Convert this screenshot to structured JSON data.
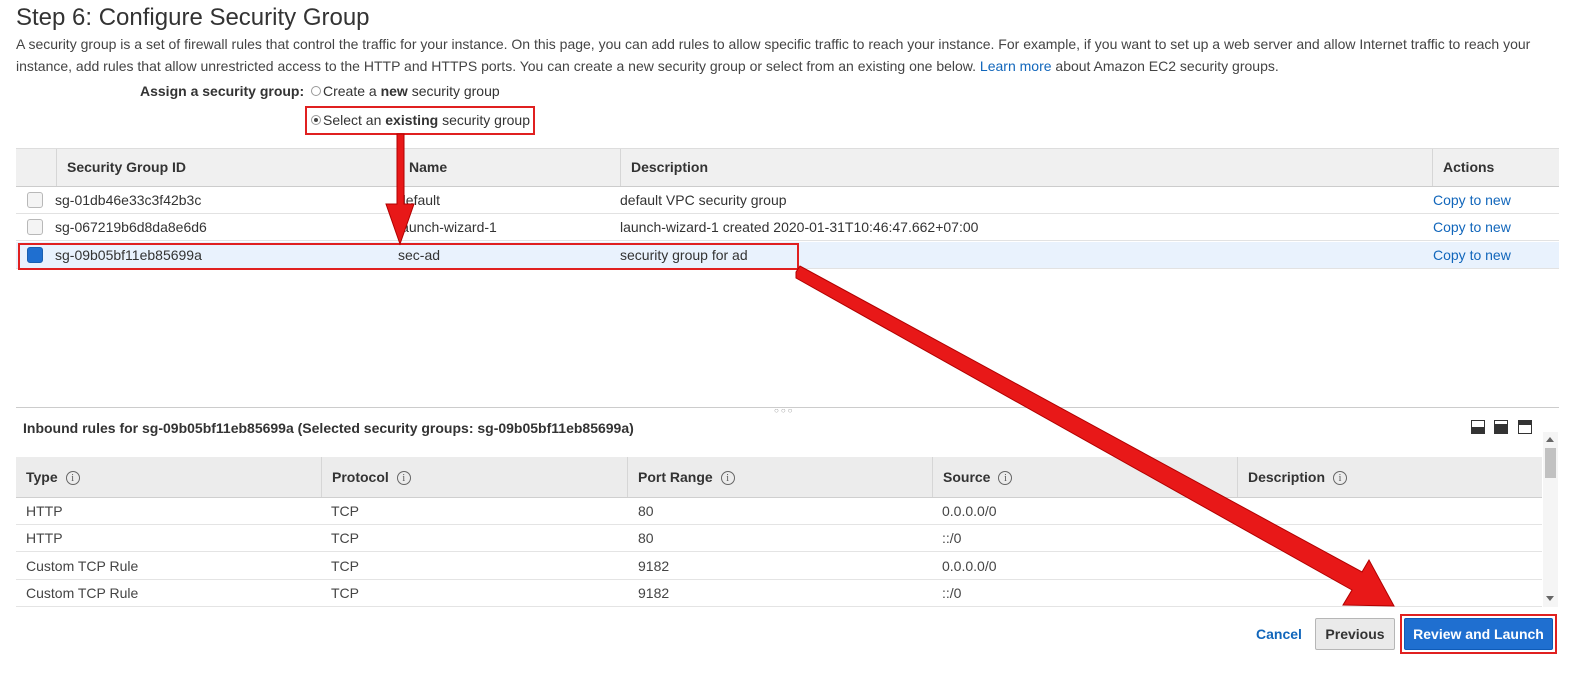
{
  "header": {
    "title": "Step 6: Configure Security Group",
    "description_part1": "A security group is a set of firewall rules that control the traffic for your instance. On this page, you can add rules to allow specific traffic to reach your instance. For example, if you want to set up a web server and allow Internet traffic to reach your instance, add rules that allow unrestricted access to the HTTP and HTTPS ports. You can create a new security group or select from an existing one below.",
    "learn_more": "Learn more",
    "description_part2": "about Amazon EC2 security groups."
  },
  "assign": {
    "label": "Assign a security group:",
    "option_new": {
      "prefix": "Create a ",
      "bold": "new",
      "suffix": " security group",
      "selected": false
    },
    "option_existing": {
      "prefix": "Select an ",
      "bold": "existing",
      "suffix": " security group",
      "selected": true
    }
  },
  "sg_table": {
    "columns": [
      "Security Group ID",
      "Name",
      "Description",
      "Actions"
    ],
    "rows": [
      {
        "id": "sg-01db46e33c3f42b3c",
        "name": "default",
        "description": "default VPC security group",
        "action": "Copy to new",
        "selected": false
      },
      {
        "id": "sg-067219b6d8da8e6d6",
        "name": "launch-wizard-1",
        "description": "launch-wizard-1 created 2020-01-31T10:46:47.662+07:00",
        "action": "Copy to new",
        "selected": false
      },
      {
        "id": "sg-09b05bf11eb85699a",
        "name": "sec-ad",
        "description": "security group for ad",
        "action": "Copy to new",
        "selected": true
      }
    ]
  },
  "inbound": {
    "title": "Inbound rules for sg-09b05bf11eb85699a (Selected security groups: sg-09b05bf11eb85699a)",
    "columns": [
      "Type",
      "Protocol",
      "Port Range",
      "Source",
      "Description"
    ],
    "info_glyph": "i",
    "rows": [
      {
        "type": "HTTP",
        "protocol": "TCP",
        "port": "80",
        "source": "0.0.0.0/0",
        "description": ""
      },
      {
        "type": "HTTP",
        "protocol": "TCP",
        "port": "80",
        "source": "::/0",
        "description": ""
      },
      {
        "type": "Custom TCP Rule",
        "protocol": "TCP",
        "port": "9182",
        "source": "0.0.0.0/0",
        "description": ""
      },
      {
        "type": "Custom TCP Rule",
        "protocol": "TCP",
        "port": "9182",
        "source": "::/0",
        "description": ""
      }
    ]
  },
  "footer": {
    "cancel": "Cancel",
    "previous": "Previous",
    "review_launch": "Review and Launch"
  },
  "colors": {
    "link": "#1166bb",
    "primary_button": "#1f6fd0",
    "annotation": "#e02020",
    "selected_row": "#e9f2fd"
  },
  "icons": [
    "radio-unchecked-icon",
    "radio-checked-icon",
    "checkbox-icon",
    "info-icon",
    "pane-layout-icon",
    "scroll-up-icon",
    "scroll-down-icon"
  ]
}
